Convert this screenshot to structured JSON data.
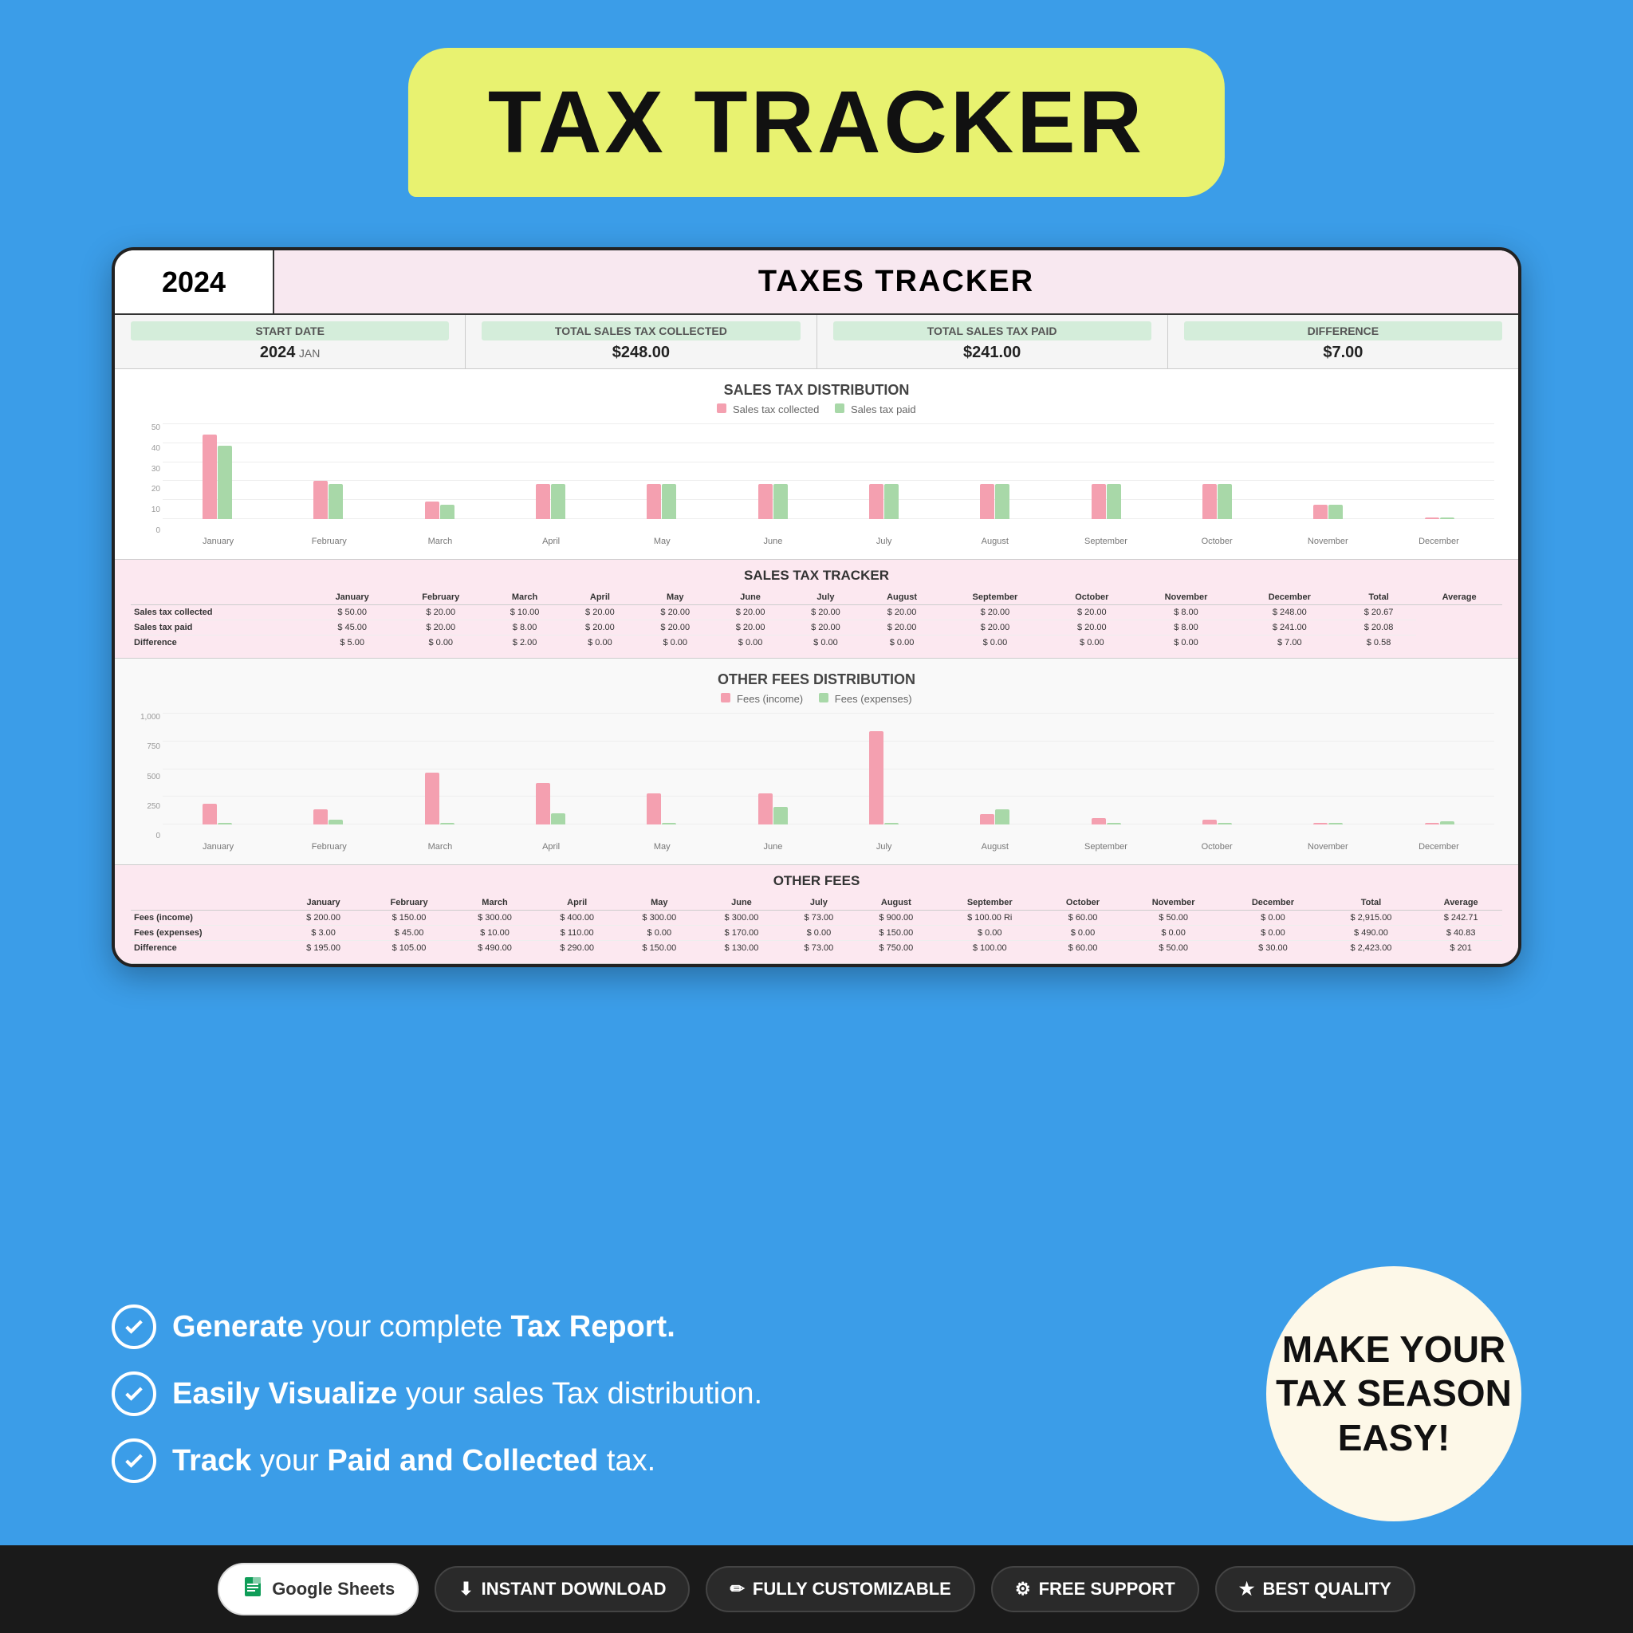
{
  "title": "TAX TRACKER",
  "year": "2024",
  "spreadsheet_title": "TAXES TRACKER",
  "summary": {
    "start_date_label": "START DATE",
    "start_date_value": "2024",
    "start_date_month": "JAN",
    "total_collected_label": "TOTAL SALES TAX COLLECTED",
    "total_collected_value": "$248.00",
    "total_paid_label": "TOTAL SALES TAX PAID",
    "total_paid_value": "$241.00",
    "difference_label": "DIFFERENCE",
    "difference_value": "$7.00"
  },
  "sales_tax_chart": {
    "title": "SALES TAX DISTRIBUTION",
    "legend_collected": "Sales tax collected",
    "legend_paid": "Sales tax paid",
    "months": [
      "January",
      "February",
      "March",
      "April",
      "May",
      "June",
      "July",
      "August",
      "September",
      "October",
      "November",
      "December"
    ],
    "collected": [
      48,
      22,
      10,
      20,
      20,
      20,
      20,
      20,
      20,
      20,
      8,
      0
    ],
    "paid": [
      42,
      20,
      8,
      20,
      20,
      20,
      20,
      20,
      20,
      20,
      8,
      0
    ]
  },
  "sales_tax_table": {
    "title": "SALES TAX TRACKER",
    "headers": [
      "",
      "",
      "January",
      "",
      "February",
      "",
      "March",
      "",
      "April",
      "",
      "May",
      "",
      "June",
      "",
      "July",
      "",
      "August",
      "",
      "September",
      "",
      "October",
      "",
      "November",
      "",
      "December",
      "",
      "Total",
      "",
      "Average"
    ],
    "rows": [
      {
        "label": "Sales tax collected",
        "values": [
          "$",
          "50.00",
          "$",
          "20.00",
          "$",
          "10.00",
          "$",
          "20.00",
          "$",
          "20.00",
          "$",
          "20.00",
          "$",
          "20.00",
          "$",
          "20.00",
          "$",
          "20.00",
          "$",
          "20.00",
          "$",
          "8.00",
          "$",
          "248.00",
          "$",
          "20.67"
        ]
      },
      {
        "label": "Sales tax paid",
        "values": [
          "$",
          "45.00",
          "$",
          "20.00",
          "$",
          "8.00",
          "$",
          "20.00",
          "$",
          "20.00",
          "$",
          "20.00",
          "$",
          "20.00",
          "$",
          "20.00",
          "$",
          "20.00",
          "$",
          "20.00",
          "$",
          "8.00",
          "$",
          "241.00",
          "$",
          "20.08"
        ]
      },
      {
        "label": "Difference",
        "values": [
          "$",
          "5.00",
          "$",
          "0.00",
          "$",
          "2.00",
          "$",
          "0.00",
          "$",
          "0.00",
          "$",
          "0.00",
          "$",
          "0.00",
          "$",
          "0.00",
          "$",
          "0.00",
          "$",
          "0.00",
          "$",
          "0.00",
          "$",
          "7.00",
          "$",
          "0.58"
        ]
      }
    ]
  },
  "other_fees_chart": {
    "title": "OTHER FEES DISTRIBUTION",
    "legend_income": "Fees (income)",
    "legend_expenses": "Fees (expenses)",
    "months": [
      "January",
      "February",
      "March",
      "April",
      "May",
      "June",
      "July",
      "August",
      "September",
      "October",
      "November",
      "December"
    ],
    "income": [
      200,
      150,
      500,
      400,
      300,
      300,
      900,
      100,
      60,
      50,
      0
    ],
    "expenses": [
      3,
      45,
      10,
      110,
      0,
      170,
      0,
      150,
      0,
      0,
      0,
      30
    ]
  },
  "other_fees_table": {
    "title": "OTHER FEES",
    "rows": [
      {
        "label": "Fees (income)",
        "values": [
          "$",
          "200.00",
          "$",
          "150.00",
          "$",
          "300.00",
          "$",
          "400.00",
          "$",
          "300.00",
          "$",
          "300.00",
          "$",
          "73.00",
          "$",
          "900.00",
          "$",
          "100.00 Ri",
          "$",
          "60.00",
          "$",
          "50.00",
          "$",
          "0.00",
          "$",
          "2,915.00",
          "$",
          "242.71"
        ]
      },
      {
        "label": "Fees (expenses)",
        "values": [
          "$",
          "3.00",
          "$",
          "45.00",
          "$",
          "10.00",
          "$",
          "110.00",
          "$",
          "0.00",
          "$",
          "170.00",
          "$",
          "0.00",
          "$",
          "150.00",
          "$",
          "0.00",
          "$",
          "0.00",
          "$",
          "0.00",
          "$",
          "0.00",
          "$",
          "490.00",
          "$",
          "40.83"
        ]
      },
      {
        "label": "Difference",
        "values": [
          "$",
          "195.00",
          "$",
          "105.00",
          "$",
          "490.00",
          "$",
          "290.00",
          "$",
          "150.00",
          "$",
          "130.00",
          "$",
          "73.00",
          "$",
          "750.00",
          "$",
          "100.00",
          "$",
          "60.00",
          "$",
          "50.00",
          "$",
          "30.00",
          "$",
          "2,423.00",
          "$",
          "201"
        ]
      }
    ]
  },
  "features": [
    {
      "text_plain": "Generate",
      "text_bold": "your complete",
      "text_bold2": "Tax Report."
    },
    {
      "text_plain": "Easily Visualize",
      "text_bold": "your sales Tax distribution."
    },
    {
      "text_plain": "Track",
      "text_bold": "your",
      "text_bold2": "Paid and Collected",
      "text_plain2": "tax."
    }
  ],
  "cta": "MAKE YOUR TAX SEASON EASY!",
  "bottom_badges": [
    {
      "icon": "🟢",
      "label": "Google Sheets"
    },
    {
      "icon": "⬇",
      "label": "INSTANT DOWNLOAD"
    },
    {
      "icon": "✏",
      "label": "FULLY CUSTOMIZABLE"
    },
    {
      "icon": "⚙",
      "label": "FREE SUPPORT"
    },
    {
      "icon": "★",
      "label": "BEST QUALITY"
    }
  ]
}
